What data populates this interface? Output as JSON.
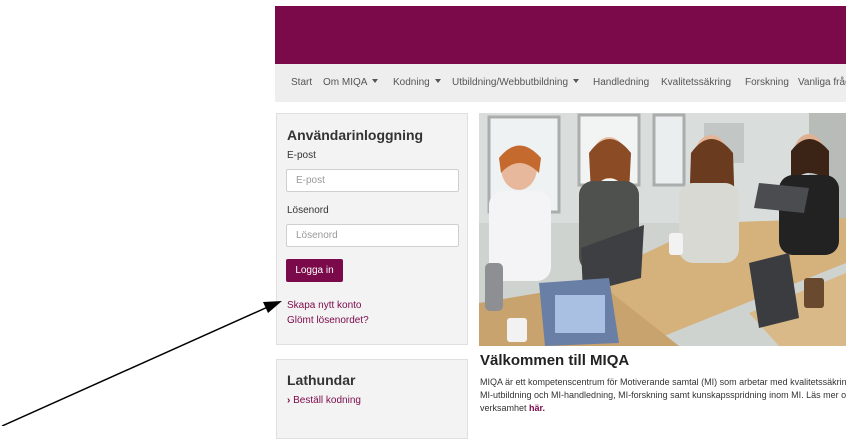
{
  "colors": {
    "brand": "#7b0a4a",
    "nav_bg": "#eeeeee",
    "panel_bg": "#f3f3f3"
  },
  "nav": {
    "items": [
      {
        "label": "Start",
        "dropdown": false
      },
      {
        "label": "Om MIQA",
        "dropdown": true
      },
      {
        "label": "Kodning",
        "dropdown": true
      },
      {
        "label": "Utbildning/Webbutbildning",
        "dropdown": true
      },
      {
        "label": "Handledning",
        "dropdown": false
      },
      {
        "label": "Kvalitetssäkring",
        "dropdown": false
      },
      {
        "label": "Forskning",
        "dropdown": false
      },
      {
        "label": "Vanliga frågor",
        "dropdown": false
      }
    ]
  },
  "login": {
    "title": "Användarinloggning",
    "email_label": "E-post",
    "email_placeholder": "E-post",
    "password_label": "Lösenord",
    "password_placeholder": "Lösenord",
    "submit_label": "Logga in",
    "create_account_link": "Skapa nytt konto",
    "forgot_password_link": "Glömt lösenordet?"
  },
  "lathundar": {
    "title": "Lathundar",
    "order_link": "Beställ kodning"
  },
  "welcome": {
    "title": "Välkommen till MIQA",
    "line1": "MIQA är ett kompetenscentrum för Motiverande samtal (MI) som arbetar med kvalitetssäkring av",
    "line2": "MI-utbildning och MI-handledning, MI-forskning samt kunskapsspridning inom MI. Läs mer om vår",
    "line3_prefix": "verksamhet ",
    "line3_link": "här."
  },
  "hero_image": {
    "icon": "photo-people-at-laptops"
  },
  "annotation": {
    "icon": "arrow-pointer"
  }
}
